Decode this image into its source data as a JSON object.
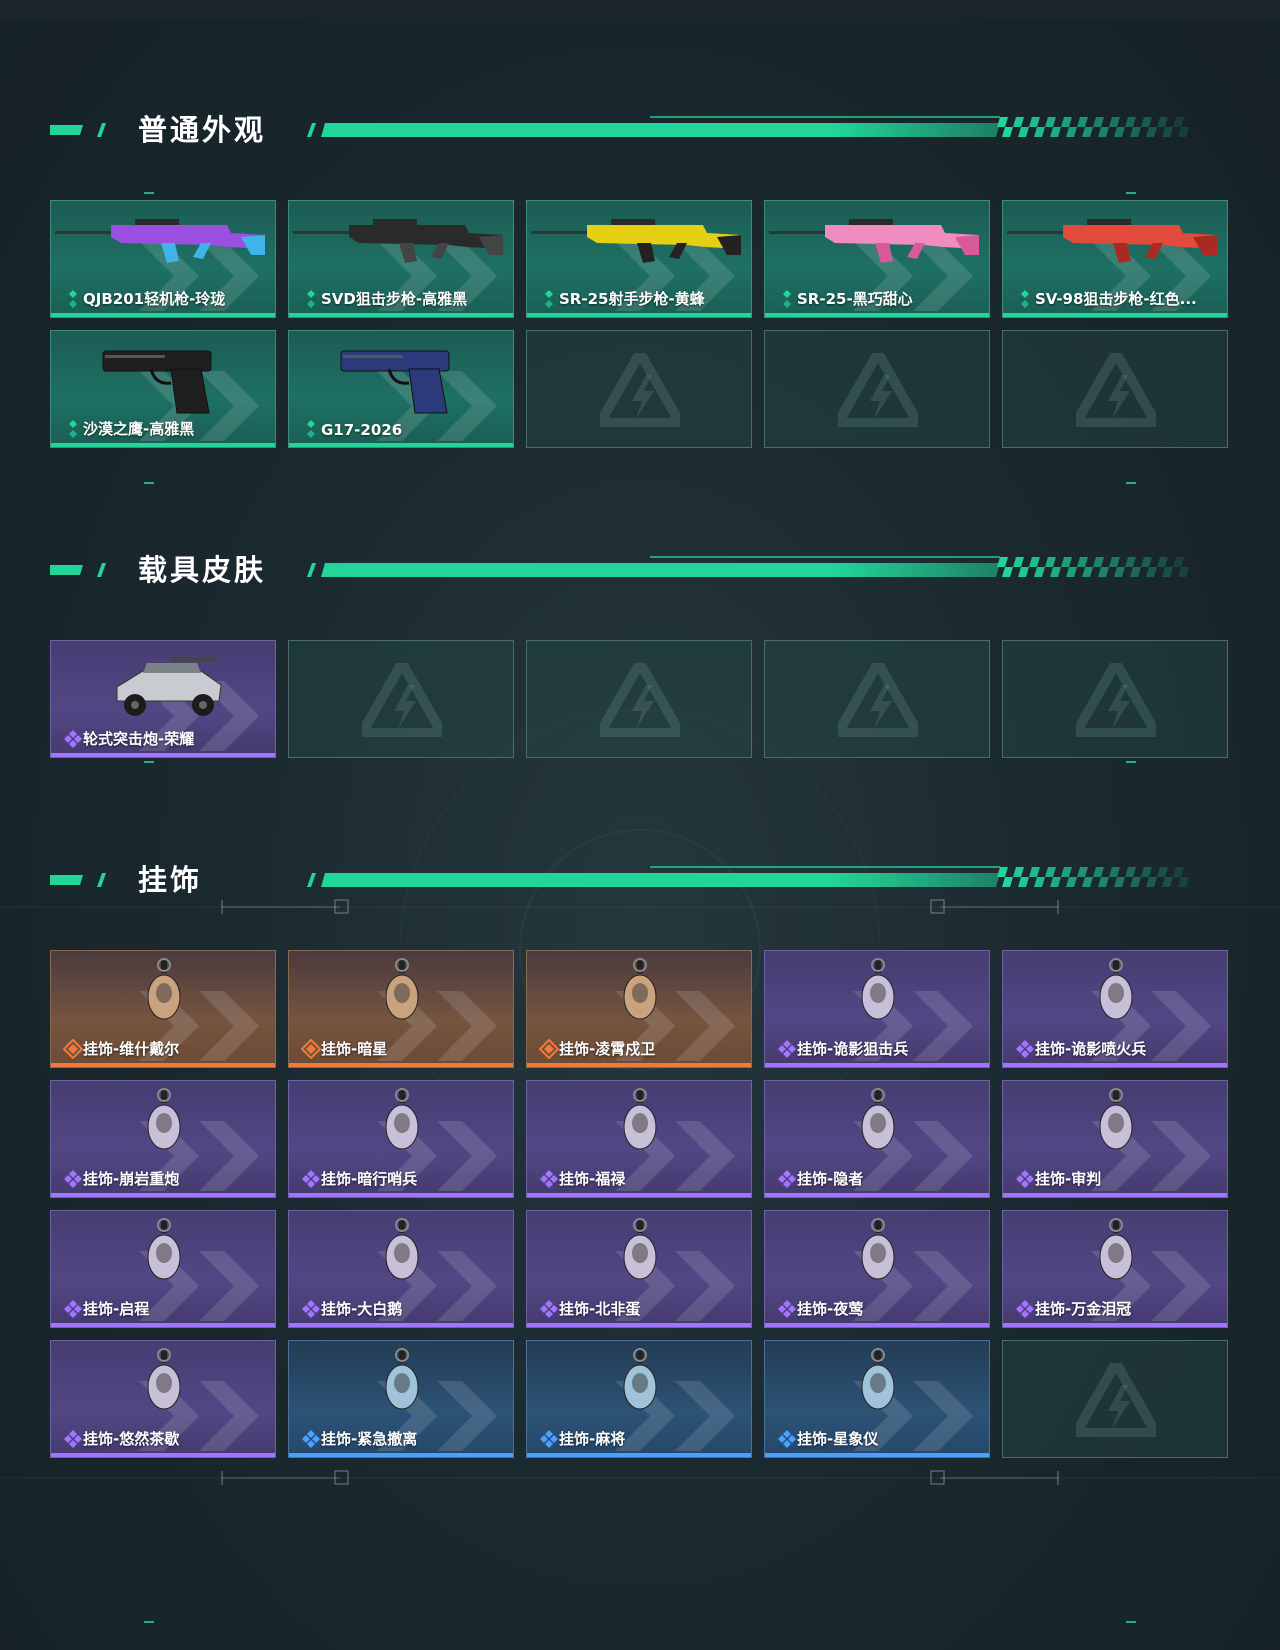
{
  "colors": {
    "accent": "#22d69a",
    "rarity_green": "#22d69a",
    "rarity_purple": "#a274ff",
    "rarity_orange": "#f07a3a",
    "rarity_blue": "#4aa0ff"
  },
  "sections": [
    {
      "title": "普通外观",
      "items": [
        {
          "label": "QJB201轻机枪-玲珑",
          "rarity": "green",
          "icon": "rifle-icon"
        },
        {
          "label": "SVD狙击步枪-高雅黑",
          "rarity": "green",
          "icon": "rifle-icon"
        },
        {
          "label": "SR-25射手步枪-黄蜂",
          "rarity": "green",
          "icon": "rifle-icon"
        },
        {
          "label": "SR-25-黑巧甜心",
          "rarity": "green",
          "icon": "rifle-icon"
        },
        {
          "label": "SV-98狙击步枪-红色...",
          "rarity": "green",
          "icon": "rifle-icon"
        },
        {
          "label": "沙漠之鹰-高雅黑",
          "rarity": "green",
          "icon": "pistol-icon"
        },
        {
          "label": "G17-2026",
          "rarity": "green",
          "icon": "pistol-icon"
        }
      ],
      "empty_slots": 3
    },
    {
      "title": "载具皮肤",
      "items": [
        {
          "label": "轮式突击炮-荣耀",
          "rarity": "purple",
          "icon": "vehicle-icon"
        }
      ],
      "empty_slots": 4
    },
    {
      "title": "挂饰",
      "items": [
        {
          "label": "挂饰-维什戴尔",
          "rarity": "orange",
          "icon": "charm-icon"
        },
        {
          "label": "挂饰-暗星",
          "rarity": "orange",
          "icon": "charm-icon"
        },
        {
          "label": "挂饰-凌霄戍卫",
          "rarity": "orange",
          "icon": "charm-icon"
        },
        {
          "label": "挂饰-诡影狙击兵",
          "rarity": "purple",
          "icon": "charm-icon"
        },
        {
          "label": "挂饰-诡影喷火兵",
          "rarity": "purple",
          "icon": "charm-icon"
        },
        {
          "label": "挂饰-崩岩重炮",
          "rarity": "purple",
          "icon": "charm-icon"
        },
        {
          "label": "挂饰-暗行哨兵",
          "rarity": "purple",
          "icon": "charm-icon"
        },
        {
          "label": "挂饰-福禄",
          "rarity": "purple",
          "icon": "charm-icon"
        },
        {
          "label": "挂饰-隐者",
          "rarity": "purple",
          "icon": "charm-icon"
        },
        {
          "label": "挂饰-审判",
          "rarity": "purple",
          "icon": "charm-icon"
        },
        {
          "label": "挂饰-启程",
          "rarity": "purple",
          "icon": "charm-icon"
        },
        {
          "label": "挂饰-大白鹅",
          "rarity": "purple",
          "icon": "charm-icon"
        },
        {
          "label": "挂饰-北非蛋",
          "rarity": "purple",
          "icon": "charm-icon"
        },
        {
          "label": "挂饰-夜莺",
          "rarity": "purple",
          "icon": "charm-icon"
        },
        {
          "label": "挂饰-万金泪冠",
          "rarity": "purple",
          "icon": "charm-icon"
        },
        {
          "label": "挂饰-悠然茶歇",
          "rarity": "purple",
          "icon": "charm-icon"
        },
        {
          "label": "挂饰-紧急撤离",
          "rarity": "blue",
          "icon": "charm-icon"
        },
        {
          "label": "挂饰-麻将",
          "rarity": "blue",
          "icon": "charm-icon"
        },
        {
          "label": "挂饰-星象仪",
          "rarity": "blue",
          "icon": "charm-icon"
        }
      ],
      "empty_slots": 1
    }
  ]
}
